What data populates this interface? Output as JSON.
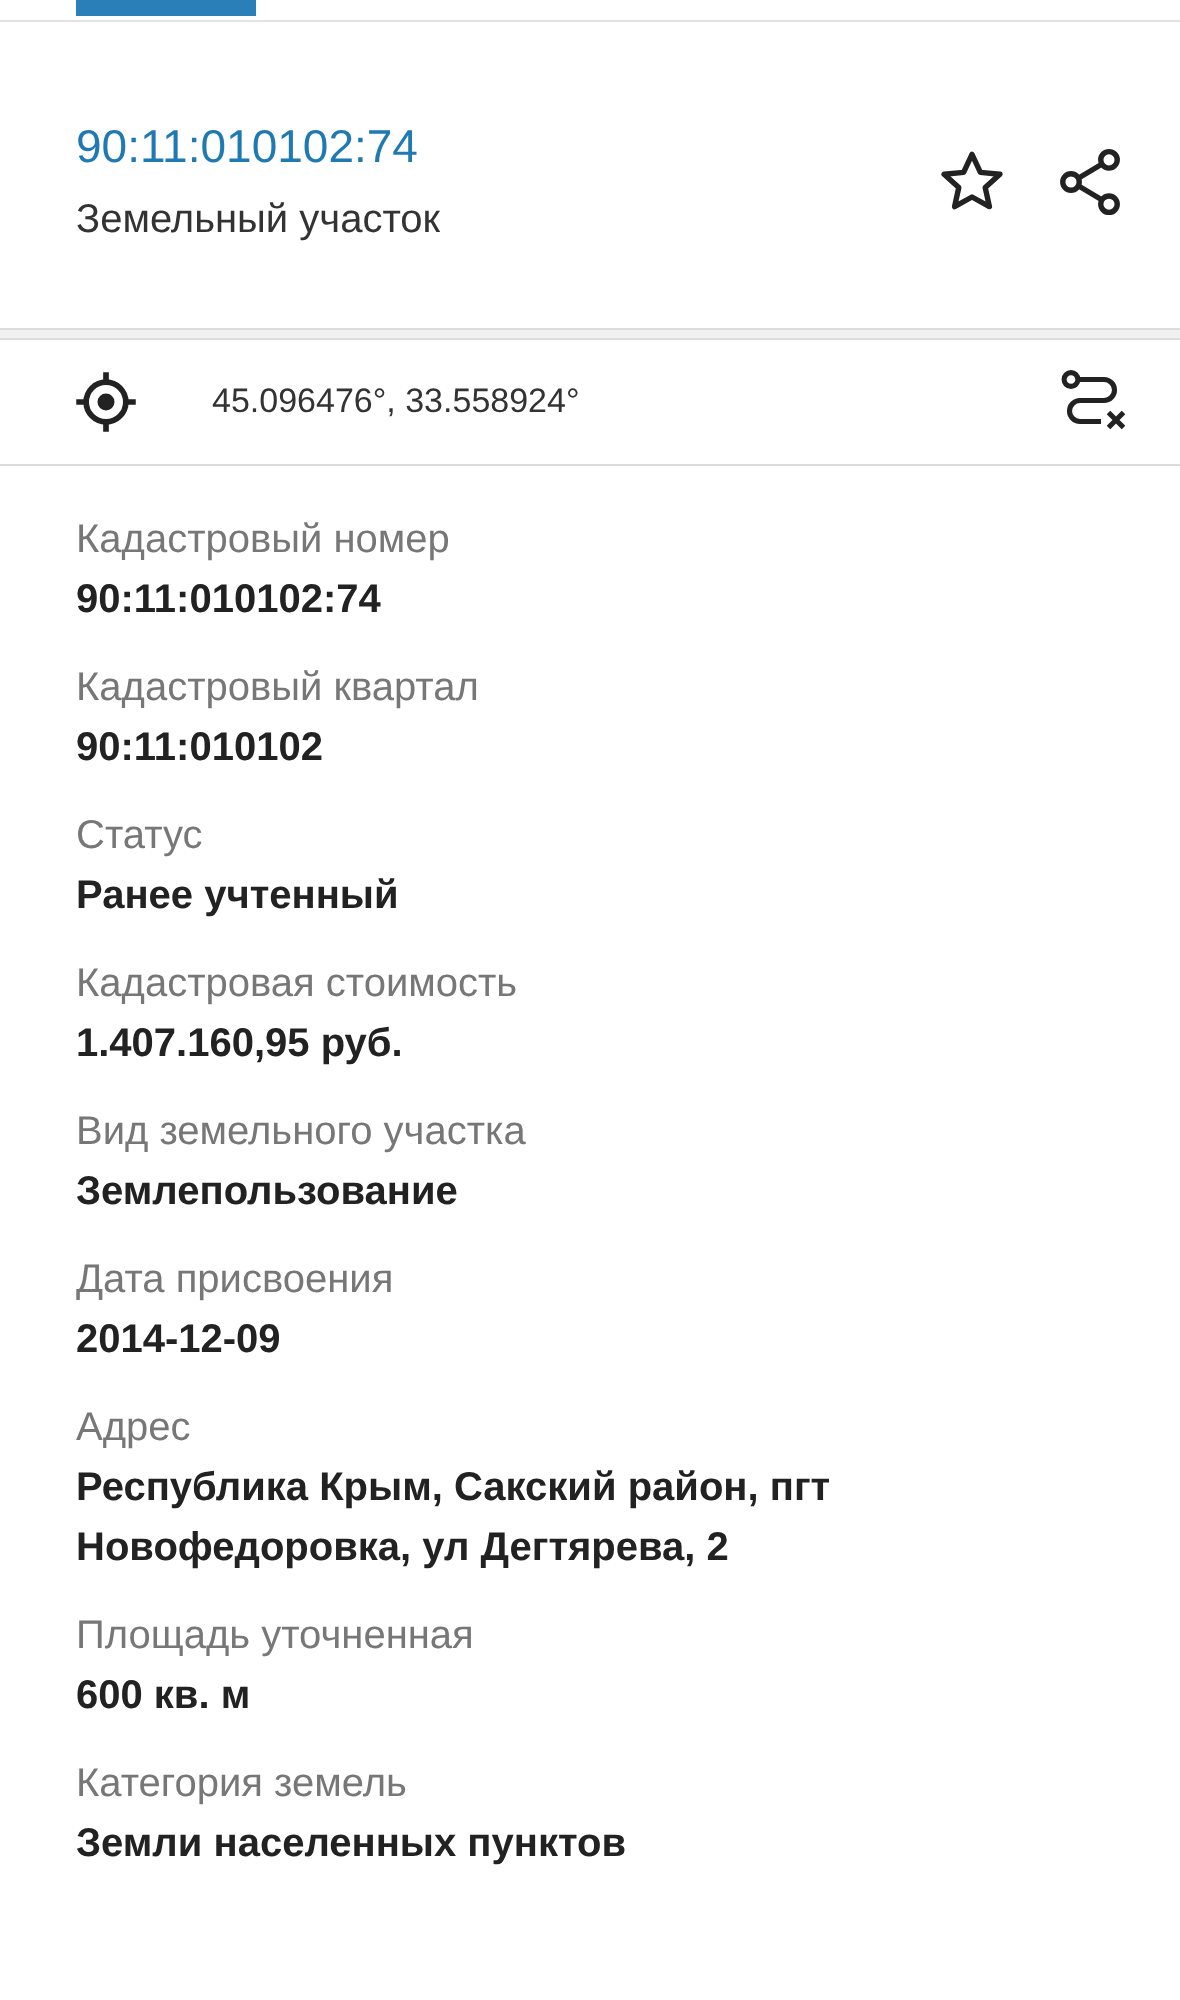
{
  "header": {
    "title": "90:11:010102:74",
    "subtitle": "Земельный участок",
    "favorite": false
  },
  "location": {
    "coordinates": "45.096476°, 33.558924°"
  },
  "fields": [
    {
      "label": "Кадастровый номер",
      "value": "90:11:010102:74"
    },
    {
      "label": "Кадастровый квартал",
      "value": "90:11:010102"
    },
    {
      "label": "Статус",
      "value": "Ранее учтенный"
    },
    {
      "label": "Кадастровая стоимость",
      "value": "1.407.160,95 руб."
    },
    {
      "label": "Вид земельного участка",
      "value": "Землепользование"
    },
    {
      "label": "Дата присвоения",
      "value": "2014-12-09"
    },
    {
      "label": "Адрес",
      "value": "Республика Крым, Сакский район, пгт Новофедоровка, ул Дегтярева, 2"
    },
    {
      "label": "Площадь уточненная",
      "value": "600 кв. м"
    },
    {
      "label": "Категория земель",
      "value": "Земли населенных пунктов"
    }
  ]
}
